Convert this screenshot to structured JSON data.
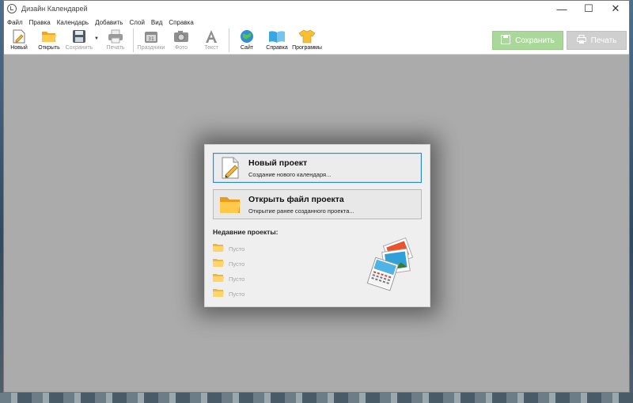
{
  "window": {
    "title": "Дизайн Календарей",
    "controls": [
      "—",
      "☐",
      "✕"
    ]
  },
  "menu": [
    "Файл",
    "Правка",
    "Календарь",
    "Добавить",
    "Слой",
    "Вид",
    "Справка"
  ],
  "toolbar": {
    "new": "Новый",
    "open": "Открыть",
    "save": "Сохранить",
    "print": "Печать",
    "holidays": "Праздники",
    "photo": "Фото",
    "text": "Текст",
    "site": "Сайт",
    "help": "Справка",
    "programs": "Программы",
    "save_button": "Сохранить",
    "print_button": "Печать"
  },
  "colors": {
    "workspace": "#ababab",
    "save_button": "#a9d89a",
    "print_button": "#cfcfcf",
    "accent": "#2b8bd0"
  },
  "dialog": {
    "new_project": {
      "title": "Новый проект",
      "subtitle": "Создание нового календаря..."
    },
    "open_project": {
      "title": "Открыть файл проекта",
      "subtitle": "Открытие ранее созданного проекта..."
    },
    "recent_title": "Недавние проекты:",
    "recent_items": [
      "Пусто",
      "Пусто",
      "Пусто",
      "Пусто"
    ]
  }
}
